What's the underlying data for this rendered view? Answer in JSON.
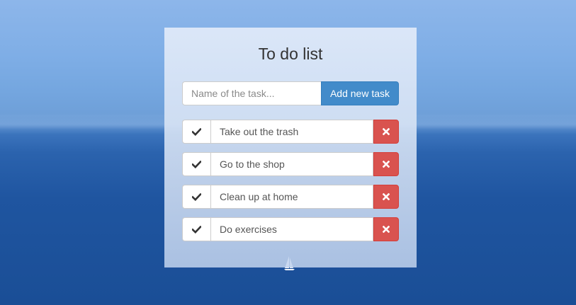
{
  "app": {
    "title": "To do list"
  },
  "add_form": {
    "placeholder": "Name of the task...",
    "value": "",
    "button_label": "Add new task"
  },
  "tasks": [
    {
      "label": "Take out the trash"
    },
    {
      "label": "Go to the shop"
    },
    {
      "label": "Clean up at home"
    },
    {
      "label": "Do exercises"
    }
  ],
  "icons": {
    "complete": "check-icon",
    "delete": "close-icon"
  },
  "colors": {
    "primary": "#428bca",
    "danger": "#d9534f",
    "text": "#555555",
    "title": "#333333"
  }
}
